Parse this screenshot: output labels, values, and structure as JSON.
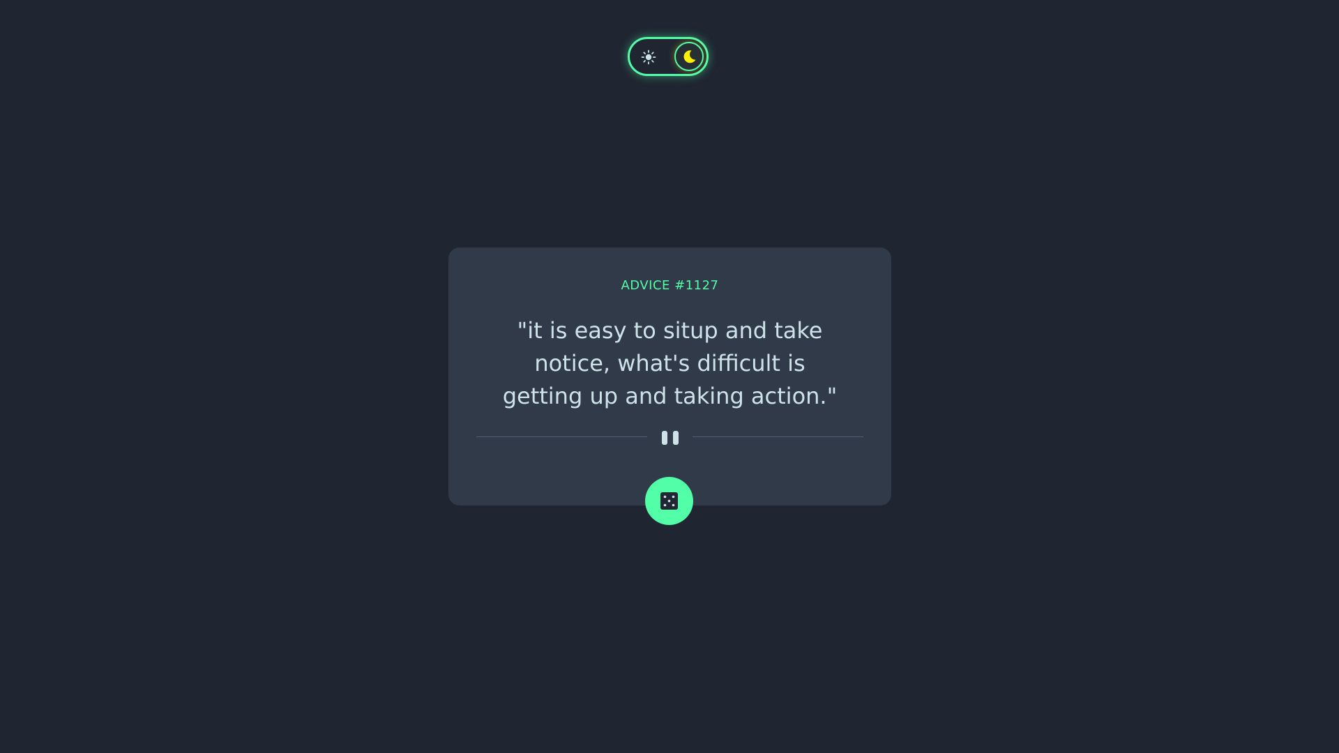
{
  "theme_toggle": {
    "light_icon": "sun-icon",
    "dark_icon": "moon-icon",
    "selected": "dark",
    "accent_color": "#52ffa8",
    "moon_color": "#fff200"
  },
  "card": {
    "advice_label": "ADVICE #1127",
    "quote": "\"it is easy to situp and take notice, what's difficult is getting up and taking action.\"",
    "divider_icon": "pause-icon"
  },
  "dice_button": {
    "icon": "dice-icon",
    "color": "#52ffa8"
  },
  "colors": {
    "background": "#1f2531",
    "card": "#313a48",
    "text": "#cee3e9",
    "accent": "#52ffa8"
  }
}
